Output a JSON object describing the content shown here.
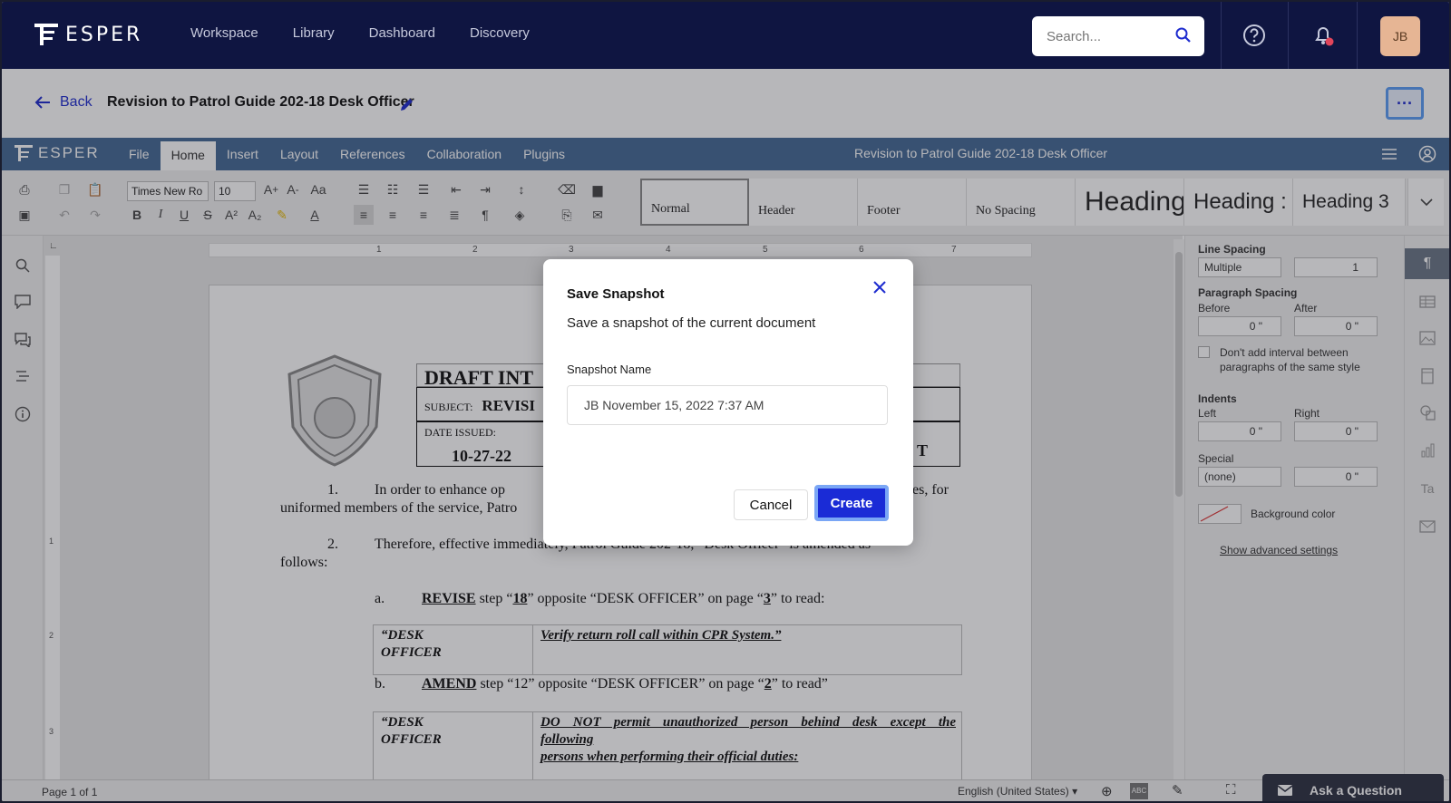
{
  "app": {
    "brand": "ESPER"
  },
  "nav": {
    "links": [
      "Workspace",
      "Library",
      "Dashboard",
      "Discovery"
    ],
    "search_placeholder": "Search...",
    "avatar_initials": "JB"
  },
  "doc_header": {
    "back_label": "Back",
    "title": "Revision to Patrol Guide 202-18 Desk Officer",
    "more_label": "···"
  },
  "editor": {
    "brand": "ESPER",
    "menus": [
      "File",
      "Home",
      "Insert",
      "Layout",
      "References",
      "Collaboration",
      "Plugins"
    ],
    "active_menu": "Home",
    "title": "Revision to Patrol Guide 202-18 Desk Officer",
    "font_family": "Times New Ro",
    "font_size": "10",
    "styles": [
      "Normal",
      "Header",
      "Footer",
      "No Spacing",
      "Heading",
      "Heading :",
      "Heading 3"
    ]
  },
  "document": {
    "heading": "DRAFT INT",
    "subject_label": "SUBJECT:",
    "subject_value": "REVISI",
    "date_label": "DATE ISSUED:",
    "date_value": "10-27-22",
    "trailing_T": "T",
    "ruler_numbers": [
      "1",
      "2",
      "3",
      "4",
      "5",
      "6",
      "7"
    ],
    "vruler_numbers": [
      "1",
      "2",
      "3",
      "4"
    ],
    "para1_num": "1.",
    "para1_line1_start": "In order to enhance op",
    "para1_line1_end": "es, for",
    "para1_line2": "uniformed members of the service, Patro",
    "para2_num": "2.",
    "para2_line1": "Therefore, effective immediately, Patrol Guide 202-18, “Desk Officer” is amended as",
    "para2_line2": "follows:",
    "item_a_letter": "a.",
    "item_a_action": "REVISE",
    "item_a_text1": " step “",
    "item_a_step": "18",
    "item_a_text2": "” opposite “DESK OFFICER” on page “",
    "item_a_page": "3",
    "item_a_text3": "” to read:",
    "table_a_left": "“DESK\nOFFICER",
    "table_a_right": "Verify return roll call within CPR System.”",
    "item_b_letter": "b.",
    "item_b_action": "AMEND",
    "item_b_text1": " step “12” opposite “DESK OFFICER” on page “",
    "item_b_page": "2",
    "item_b_text2": "” to read”",
    "table_b_left": "“DESK\nOFFICER",
    "table_b_right1": "DO NOT permit unauthorized person behind desk except the",
    "table_b_right2": "following",
    "table_b_right3": "persons when performing their official duties:"
  },
  "right_panel": {
    "line_spacing_label": "Line Spacing",
    "line_spacing_mode": "Multiple",
    "line_spacing_value": "1",
    "paragraph_spacing_label": "Paragraph Spacing",
    "before_label": "Before",
    "before_value": "0 \"",
    "after_label": "After",
    "after_value": "0 \"",
    "no_interval_label": "Don't add interval between paragraphs of the same style",
    "indents_label": "Indents",
    "left_label": "Left",
    "left_value": "0 \"",
    "right_label": "Right",
    "right_value": "0 \"",
    "special_label": "Special",
    "special_value": "(none)",
    "special_amount": "0 \"",
    "background_color_label": "Background color",
    "advanced_link": "Show advanced settings"
  },
  "status_bar": {
    "page_info": "Page 1 of 1",
    "language": "English (United States)",
    "ask_label": "Ask a Question"
  },
  "modal": {
    "title": "Save Snapshot",
    "description": "Save a snapshot of the current document",
    "field_label": "Snapshot Name",
    "field_value": "JB November 15, 2022 7:37 AM",
    "cancel_label": "Cancel",
    "create_label": "Create"
  },
  "colors": {
    "nav_bg": "#0f1541",
    "editor_bar": "#446995",
    "primary": "#1a2bd6",
    "notification_dot": "#e2455b"
  }
}
